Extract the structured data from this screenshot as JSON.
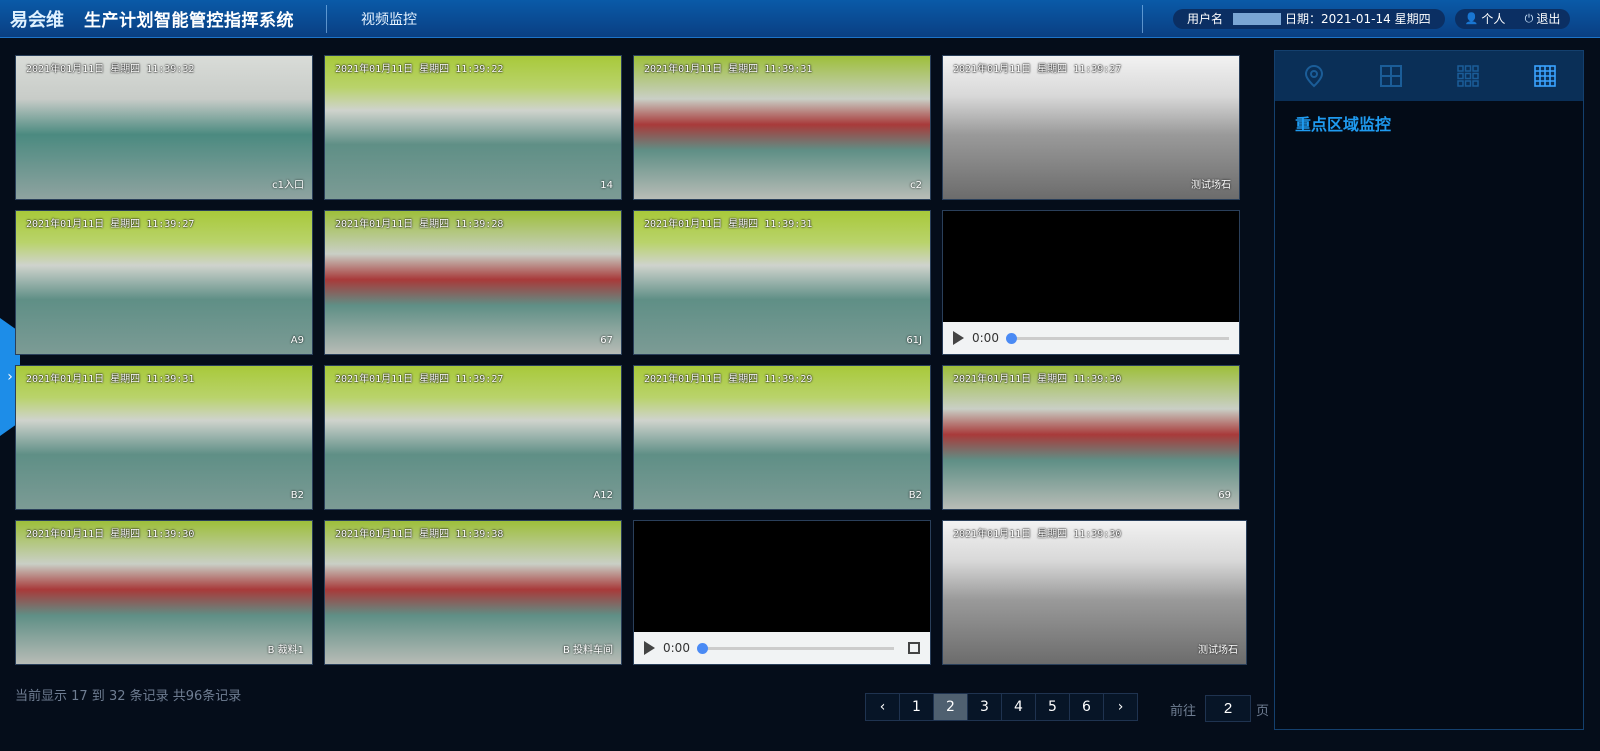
{
  "header": {
    "logo": "易会维",
    "system_title": "生产计划智能管控指挥系统",
    "module": "视频监控",
    "user_label": "用户名",
    "date_label": "日期：2021-01-14  星期四",
    "profile_label": "个人",
    "logout_label": "退出",
    "profile_icon": "user-icon",
    "logout_icon": "power-icon"
  },
  "videos": [
    {
      "timestamp": "2021年01月11日 星期四 11:39:32",
      "camera": "c1入口",
      "scene": "warehouse",
      "player": false
    },
    {
      "timestamp": "2021年01月11日 星期四 11:39:22",
      "camera": "14",
      "scene": "green",
      "player": false
    },
    {
      "timestamp": "2021年01月11日 星期四 11:39:31",
      "camera": "c2",
      "scene": "red",
      "player": false
    },
    {
      "timestamp": "2021年01月11日 星期四 11:39:27",
      "camera": "测试场石",
      "scene": "outdoor",
      "player": false
    },
    {
      "timestamp": "2021年01月11日 星期四 11:39:27",
      "camera": "A9",
      "scene": "green",
      "player": false
    },
    {
      "timestamp": "2021年01月11日 星期四 11:39:28",
      "camera": "67",
      "scene": "red",
      "player": false
    },
    {
      "timestamp": "2021年01月11日 星期四 11:39:31",
      "camera": "61J",
      "scene": "green",
      "player": false
    },
    {
      "timestamp": "",
      "camera": "",
      "scene": "black",
      "player": true,
      "time": "0:00",
      "fullscreen": false
    },
    {
      "timestamp": "2021年01月11日 星期四 11:39:31",
      "camera": "B2",
      "scene": "green",
      "player": false
    },
    {
      "timestamp": "2021年01月11日 星期四 11:39:27",
      "camera": "A12",
      "scene": "green",
      "player": false
    },
    {
      "timestamp": "2021年01月11日 星期四 11:39:29",
      "camera": "B2",
      "scene": "green",
      "player": false
    },
    {
      "timestamp": "2021年01月11日 星期四 11:39:30",
      "camera": "69",
      "scene": "red",
      "player": false
    },
    {
      "timestamp": "2021年01月11日 星期四 11:39:30",
      "camera": "B 裁料1",
      "scene": "red",
      "player": false
    },
    {
      "timestamp": "2021年01月11日 星期四 11:39:38",
      "camera": "B 投料车间",
      "scene": "red",
      "player": false
    },
    {
      "timestamp": "",
      "camera": "",
      "scene": "black",
      "player": true,
      "time": "0:00",
      "fullscreen": true
    },
    {
      "timestamp": "2021年01月11日 星期四 11:39:30",
      "camera": "测试场石",
      "scene": "outdoor",
      "player": false
    }
  ],
  "pagination": {
    "summary": "当前显示 17 到 32 条记录 共96条记录",
    "prev": "‹",
    "next": "›",
    "pages": [
      "1",
      "2",
      "3",
      "4",
      "5",
      "6"
    ],
    "current": "2",
    "goto_label": "前往",
    "goto_value": "2",
    "page_unit": "页"
  },
  "sidebar_toggle": "›",
  "right_panel": {
    "title": "重点区域监控",
    "tabs": [
      "location-icon",
      "grid-4-icon",
      "grid-9-icon",
      "grid-16-icon"
    ]
  }
}
